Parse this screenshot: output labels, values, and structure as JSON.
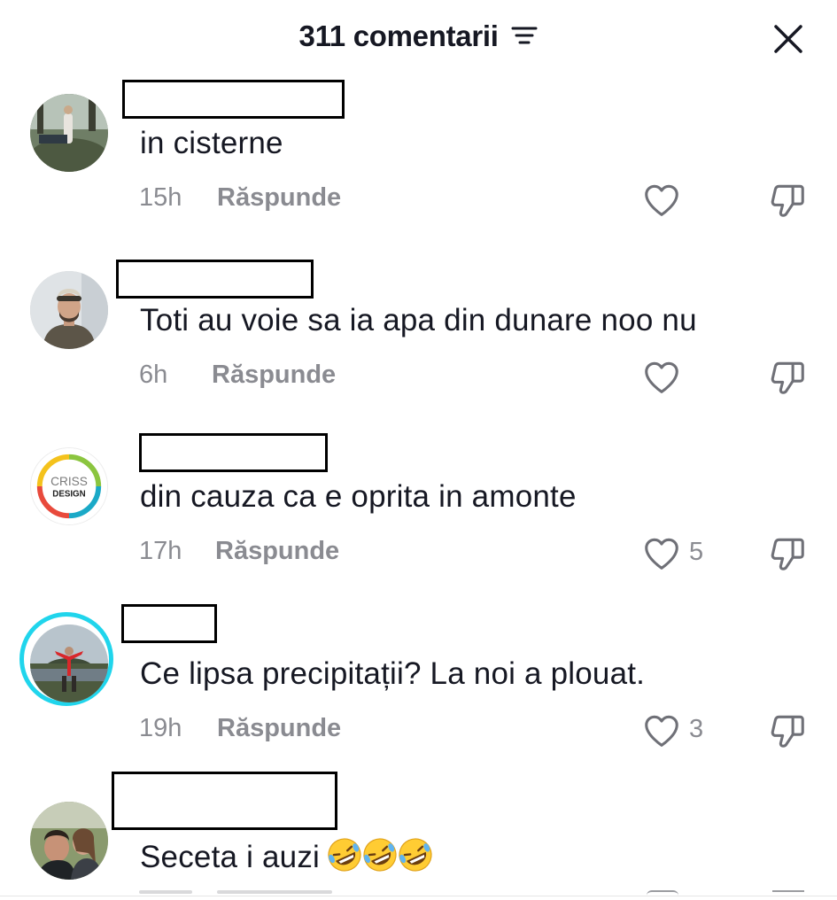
{
  "header": {
    "title": "311 comentarii"
  },
  "comments": [
    {
      "text": "in cisterne",
      "time": "15h",
      "reply": "Răspunde",
      "likes": ""
    },
    {
      "text": "Toti au voie sa ia apa din dunare noo nu",
      "time": "6h",
      "reply": "Răspunde",
      "likes": ""
    },
    {
      "text": "din cauza ca e oprita in amonte",
      "time": "17h",
      "reply": "Răspunde",
      "likes": "5",
      "avatar_text": [
        "CRISS",
        "DESIGN"
      ]
    },
    {
      "text": "Ce lipsa precipitații? La noi a plouat.",
      "time": "19h",
      "reply": "Răspunde",
      "likes": "3"
    },
    {
      "text": "Seceta i auzi",
      "time": "",
      "reply": "",
      "likes": "",
      "emoji": "rolling-on-floor-laughing x3"
    }
  ],
  "colors": {
    "text": "#161823",
    "muted": "#8a8b91",
    "story_ring": "#20d5ec"
  }
}
